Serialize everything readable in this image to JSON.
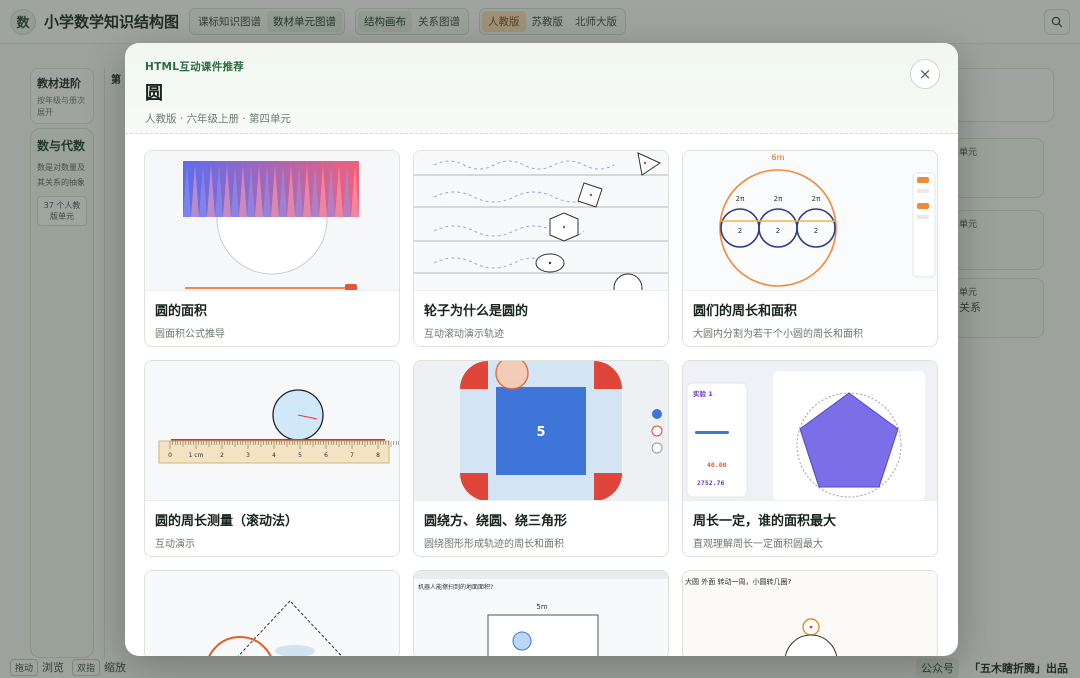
{
  "app": {
    "logo_char": "数",
    "title": "小学数学知识结构图",
    "view_tabs": [
      "课标知识图谱",
      "数材单元图谱"
    ],
    "canvas_tabs": [
      "结构画布",
      "关系图谱"
    ],
    "edition_tabs": [
      "人教版",
      "苏教版",
      "北师大版"
    ]
  },
  "background": {
    "progress_title": "教材进阶",
    "progress_sub": "按年级与册次展开",
    "col2_head": "第",
    "domain_title": "数与代数",
    "domain_desc": "数是对数量及其关系的抽象",
    "domain_badge": "37 个人教版单元",
    "right_items": [
      "单元",
      "单元",
      "单元",
      "关系"
    ]
  },
  "bottom": {
    "keys": [
      {
        "key": "拖动",
        "label": "浏览"
      },
      {
        "key": "双指",
        "label": "缩放"
      }
    ],
    "pub_label": "公众号",
    "credit": "「五木瞎折腾」出品"
  },
  "modal": {
    "eyebrow": "HTML互动课件推荐",
    "title": "圆",
    "subtitle": "人教版 · 六年级上册 · 第四单元",
    "close_symbol": "×",
    "cards": [
      {
        "title": "圆的面积",
        "desc": "圆面积公式推导"
      },
      {
        "title": "轮子为什么是圆的",
        "desc": "互动滚动演示轨迹"
      },
      {
        "title": "圆们的周长和面积",
        "desc": "大圆内分割为若干个小圆的周长和面积"
      },
      {
        "title": "圆的周长测量（滚动法）",
        "desc": "互动演示"
      },
      {
        "title": "圆绕方、绕圆、绕三角形",
        "desc": "圆绕图形形成轨迹的周长和面积"
      },
      {
        "title": "周长一定，谁的面积最大",
        "desc": "直观理解周长一定面积圆最大"
      }
    ],
    "thumbs": {
      "c3_top": "6m",
      "c3_small": [
        "2π",
        "2π",
        "2π"
      ],
      "c3_num": [
        "2",
        "2",
        "2"
      ],
      "c4_ticks": [
        "0",
        "1 cm",
        "2",
        "3",
        "4",
        "5",
        "6",
        "7",
        "8"
      ],
      "c5_num": "5",
      "c6_title": "实验 1",
      "c6_val1": "40.00",
      "c6_val2": "2752.76",
      "c8_q": "机器人能擦扫到的地面面积?",
      "c8_dim": "5m",
      "c9_q": "大圆 外面 转动一周，小圆转几圈?"
    }
  }
}
